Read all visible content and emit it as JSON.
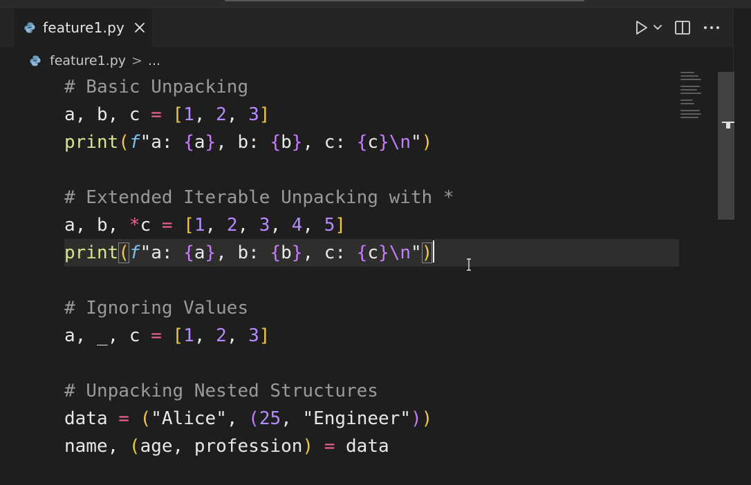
{
  "tab": {
    "filename": "feature1.py"
  },
  "breadcrumb": {
    "file": "feature1.py",
    "separator": ">",
    "more": "..."
  },
  "icons": {
    "file_icon": "python-icon",
    "close": "close-icon",
    "run": "play-icon",
    "run_menu": "chevron-down-icon",
    "split": "split-editor-icon",
    "more": "more-actions-icon"
  },
  "colors": {
    "background": "#1e1e1e",
    "comment": "#9a9a9a",
    "operator": "#f06292",
    "bracket_outer": "#f5c842",
    "bracket_inner": "#c77dff",
    "number": "#b58cff",
    "function": "#d8e58a",
    "fstring_prefix": "#76c4f0"
  },
  "code": {
    "lines": [
      "# Basic Unpacking",
      "a, b, c = [1, 2, 3]",
      "print(f\"a: {a}, b: {b}, c: {c}\\n\")",
      "",
      "# Extended Iterable Unpacking with *",
      "a, b, *c = [1, 2, 3, 4, 5]",
      "print(f\"a: {a}, b: {b}, c: {c}\\n\")",
      "",
      "# Ignoring Values",
      "a, _, c = [1, 2, 3]",
      "",
      "# Unpacking Nested Structures",
      "data = (\"Alice\", (25, \"Engineer\"))",
      "name, (age, profession) = data"
    ],
    "active_line": 7
  }
}
